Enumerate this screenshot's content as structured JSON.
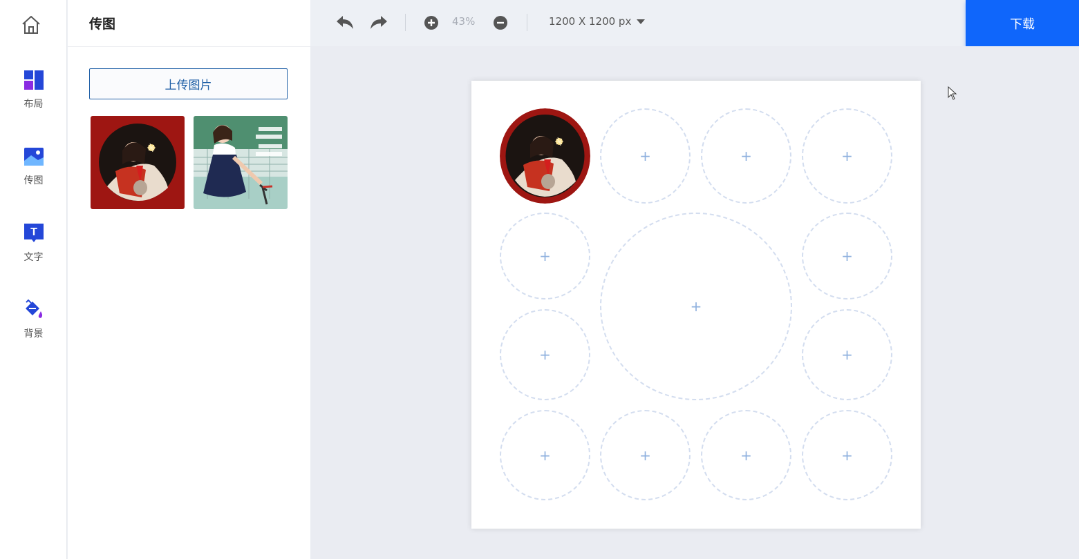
{
  "rail": {
    "items": [
      {
        "label": "布局",
        "icon": "layout-icon"
      },
      {
        "label": "传图",
        "icon": "image-upload-icon"
      },
      {
        "label": "文字",
        "icon": "text-icon"
      },
      {
        "label": "背景",
        "icon": "paint-bucket-icon"
      }
    ]
  },
  "panel": {
    "title": "传图",
    "upload_label": "上传图片"
  },
  "toolbar": {
    "zoom": "43%",
    "canvas_size": "1200 X 1200 px",
    "download_label": "下载"
  },
  "canvas": {
    "slot_symbol": "+"
  },
  "colors": {
    "accent": "#0f66fb",
    "upload_border": "#1f5fa6",
    "slot_border": "#d3ddef",
    "slot_plus": "#8eb0de"
  }
}
